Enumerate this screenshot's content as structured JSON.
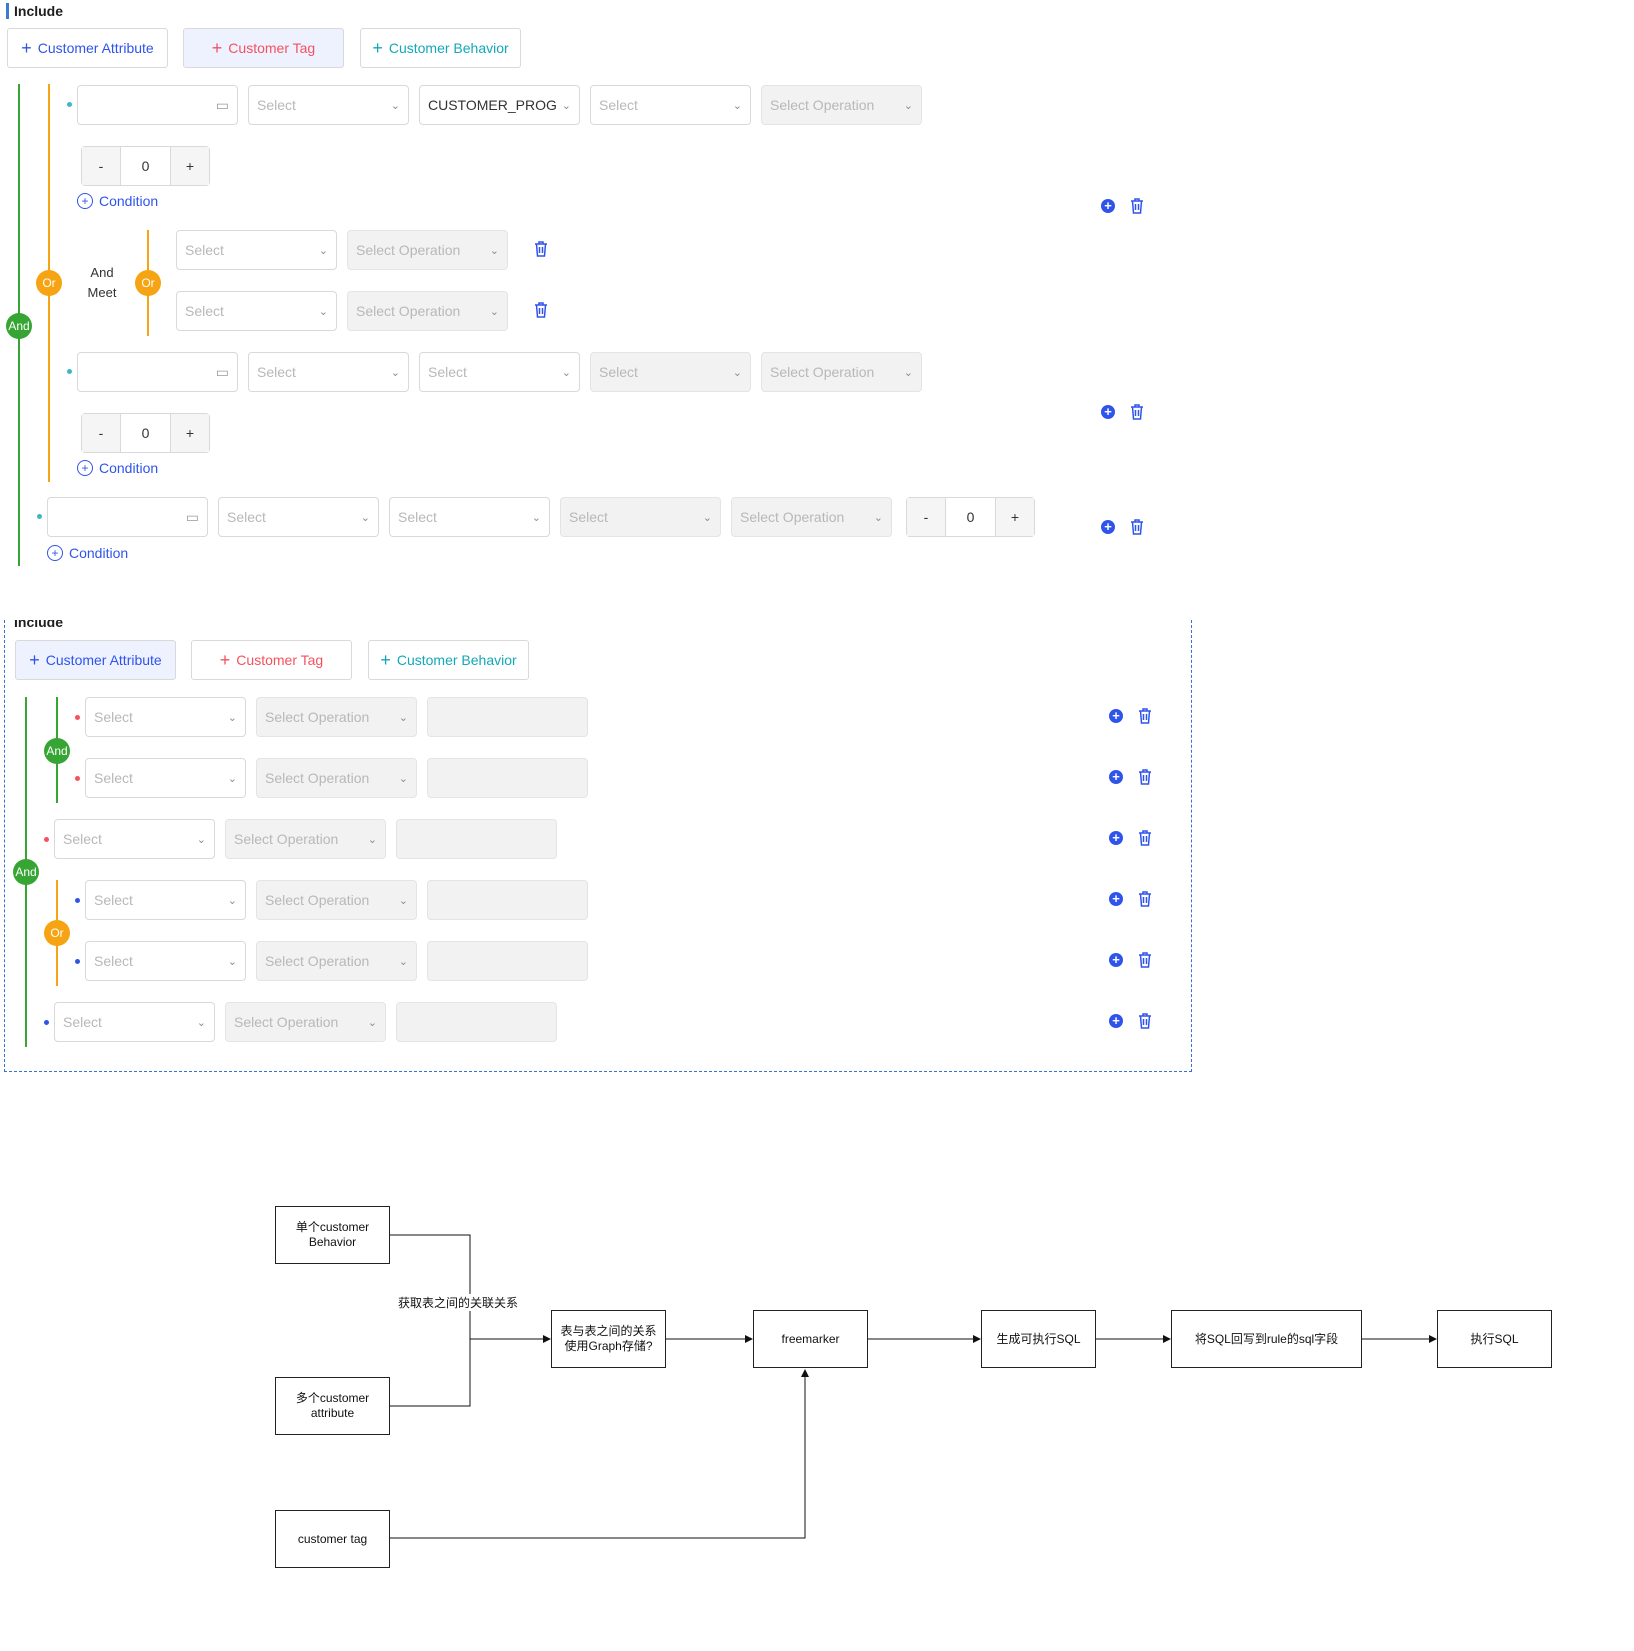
{
  "panel1": {
    "title": "Include",
    "buttons": {
      "attribute": "Customer Attribute",
      "tag": "Customer Tag",
      "behavior": "Customer Behavior"
    },
    "row1": {
      "select1": "Select",
      "select2": "CUSTOMER_PROGRAM",
      "select3": "Select",
      "operation": "Select Operation",
      "stepper_value": "0"
    },
    "condition_label": "Condition",
    "and_meet_line1": "And",
    "and_meet_line2": "Meet",
    "sub_rows": [
      {
        "select": "Select",
        "operation": "Select Operation"
      },
      {
        "select": "Select",
        "operation": "Select Operation"
      }
    ],
    "row2": {
      "select1": "Select",
      "select2": "Select",
      "select3": "Select",
      "operation": "Select Operation",
      "stepper_value": "0"
    },
    "row3": {
      "select1": "Select",
      "select2": "Select",
      "select3": "Select",
      "operation": "Select Operation",
      "stepper_value": "0"
    },
    "badge_or": "Or",
    "badge_and": "And",
    "stepper_minus": "-",
    "stepper_plus": "+"
  },
  "panel2": {
    "title": "Include",
    "buttons": {
      "attribute": "Customer Attribute",
      "tag": "Customer Tag",
      "behavior": "Customer Behavior"
    },
    "select_label": "Select",
    "operation_label": "Select Operation",
    "badge_and": "And",
    "badge_or": "Or"
  },
  "flowchart": {
    "node_behavior": "单个customer Behavior",
    "node_attribute": "多个customer attribute",
    "node_tag": "customer tag",
    "edge_label": "获取表之间的关联关系",
    "node_graph": "表与表之间的关系使用Graph存储?",
    "node_freemarker": "freemarker",
    "node_generate": "生成可执行SQL",
    "node_write": "将SQL回写到rule的sql字段",
    "node_execute": "执行SQL"
  },
  "colors": {
    "accent_blue": "#2f54eb",
    "tag_red": "#f5515f",
    "behavior_teal": "#13a8b8",
    "and_green": "#37a533",
    "or_orange": "#f6a413"
  }
}
